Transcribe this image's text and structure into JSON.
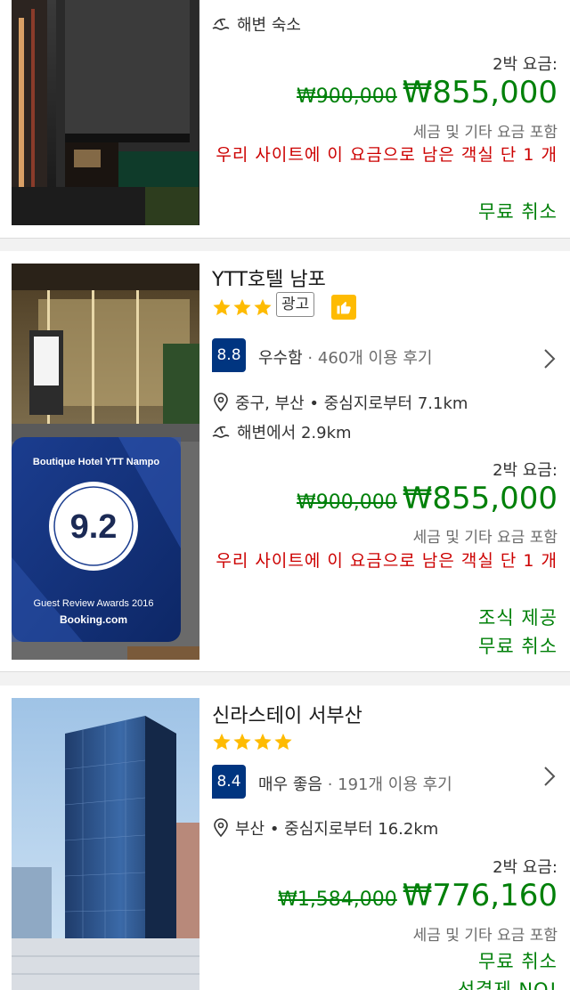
{
  "hotels": [
    {
      "name": "",
      "meta": {
        "beach_label": "해변 숙소"
      },
      "price": {
        "nights_label": "2박 요금:",
        "old_price": "₩900,000",
        "new_price": "₩855,000",
        "tax_note": "세금 및 기타 요금 포함",
        "scarcity": "우리 사이트에 이 요금으로 남은 객실 단 1 개",
        "free_cancel": "무료 취소"
      }
    },
    {
      "name": "YTT호텔 남포",
      "stars": 3,
      "ad_label": "광고",
      "score": "8.8",
      "score_word": "우수함",
      "review_count": "· 460개 이용 후기",
      "location": "중구, 부산 • 중심지로부터 7.1km",
      "beach": "해변에서 2.9km",
      "photo_text": {
        "sign_title": "Boutique Hotel YTT Nampo",
        "sign_score": "9.2",
        "sign_award": "Guest Review Awards 2016",
        "sign_brand": "Booking.com"
      },
      "price": {
        "nights_label": "2박 요금:",
        "old_price": "₩900,000",
        "new_price": "₩855,000",
        "tax_note": "세금 및 기타 요금 포함",
        "scarcity": "우리 사이트에 이 요금으로 남은 객실 단 1 개",
        "breakfast": "조식 제공",
        "free_cancel": "무료 취소"
      }
    },
    {
      "name": "신라스테이 서부산",
      "stars": 4,
      "score": "8.4",
      "score_word": "매우 좋음",
      "review_count": "· 191개 이용 후기",
      "location": "부산 • 중심지로부터 16.2km",
      "price": {
        "nights_label": "2박 요금:",
        "old_price": "₩1,584,000",
        "new_price": "₩776,160",
        "tax_note": "세금 및 기타 요금 포함",
        "free_cancel": "무료 취소",
        "no_prepay": "선결제 NO!"
      }
    }
  ],
  "colors": {
    "price_green": "#008009",
    "scarcity_red": "#cc0000",
    "score_blue": "#003580",
    "star_yellow": "#febb02"
  }
}
